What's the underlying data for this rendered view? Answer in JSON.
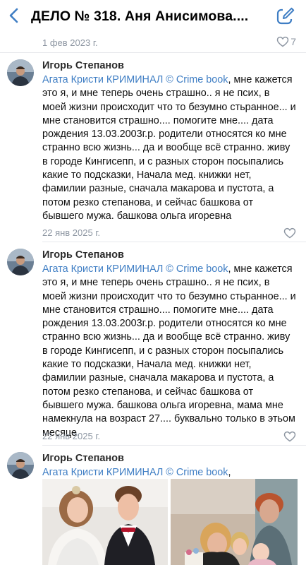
{
  "header": {
    "title": "ДЕЛО № 318. Аня Анисимова....",
    "back_icon": "chevron-left-icon",
    "edit_icon": "compose-icon"
  },
  "post_meta": {
    "date": "1 фев 2023 г.",
    "likes": "7"
  },
  "colors": {
    "accent": "#3f7ec4",
    "secondary_text": "#8d96a2"
  },
  "comments": [
    {
      "author": "Игорь Степанов",
      "reply_to": "Агата Кристи КРИМИНАЛ © Crime book",
      "text": ", мне кажется это я, и мне теперь очень страшно.. я не псих, в моей жизни происходит что то безумно стьранное... и мне становится страшно.... помогите мне.... дата рождения 13.03.2003г.р. родители относятся ко мне странно всю жизнь... да и вообще всё странно. живу в городе Кингисепп, и с разных сторон посыпались какие то подсказки,  Начала мед. книжки нет, фамилии разные, сначала макарова и пустота, а потом резко степанова, и сейчас башкова от бывшего мужа. башкова ольга игоревна",
      "date": "22 янв 2025 г."
    },
    {
      "author": "Игорь Степанов",
      "reply_to": "Агата Кристи КРИМИНАЛ © Crime book",
      "text": ", мне кажется это я, и мне теперь очень страшно.. я не псих, в моей жизни происходит что то безумно стьранное... и мне становится страшно.... помогите мне.... дата рождения 13.03.2003г.р. родители относятся ко мне странно всю жизнь... да и вообще всё странно. живу в городе Кингисепп, и с разных сторон посыпались какие то подсказки, Начала мед. книжки нет, фамилии разные, сначала макарова и пустота, а потом резко степанова, и сейчас башкова от бывшего мужа. башкова ольга игоревна, мама мне намекнула на возраст 27.... буквально только в этьом месяце.",
      "date": "22 янв 2025 г."
    },
    {
      "author": "Игорь Степанов",
      "reply_to": "Агата Кристи КРИМИНАЛ © Crime book",
      "text": ","
    }
  ]
}
